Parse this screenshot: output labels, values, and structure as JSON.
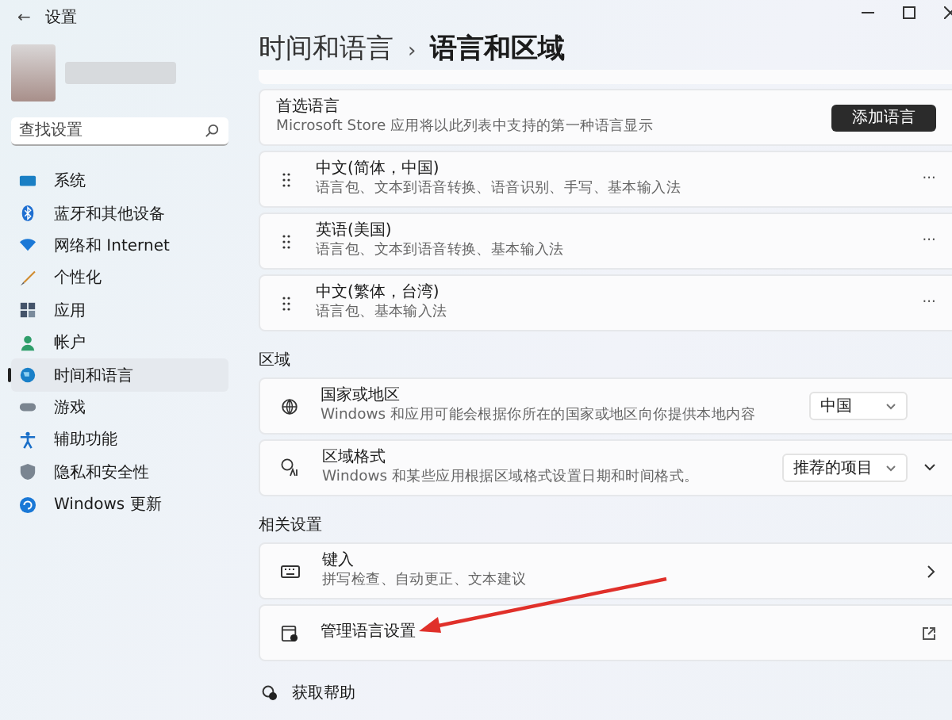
{
  "window": {
    "title": "设置",
    "back": "←"
  },
  "search": {
    "placeholder": "查找设置"
  },
  "sidebar": {
    "items": [
      {
        "label": "系统",
        "selected": false
      },
      {
        "label": "蓝牙和其他设备",
        "selected": false
      },
      {
        "label": "网络和 Internet",
        "selected": false
      },
      {
        "label": "个性化",
        "selected": false
      },
      {
        "label": "应用",
        "selected": false
      },
      {
        "label": "帐户",
        "selected": false
      },
      {
        "label": "时间和语言",
        "selected": true
      },
      {
        "label": "游戏",
        "selected": false
      },
      {
        "label": "辅助功能",
        "selected": false
      },
      {
        "label": "隐私和安全性",
        "selected": false
      },
      {
        "label": "Windows 更新",
        "selected": false
      }
    ]
  },
  "breadcrumb": {
    "parent": "时间和语言",
    "separator": "›",
    "current": "语言和区域"
  },
  "preferred_language": {
    "title": "首选语言",
    "subtitle": "Microsoft Store 应用将以此列表中支持的第一种语言显示",
    "button": "添加语言"
  },
  "languages": [
    {
      "name": "中文(简体，中国)",
      "features": "语言包、文本到语音转换、语音识别、手写、基本输入法",
      "menu": "···"
    },
    {
      "name": "英语(美国)",
      "features": "语言包、文本到语音转换、基本输入法",
      "menu": "···"
    },
    {
      "name": "中文(繁体，台湾)",
      "features": "语言包、基本输入法",
      "menu": "···"
    }
  ],
  "region": {
    "heading": "区域",
    "rows": [
      {
        "title": "国家或地区",
        "subtitle": "Windows 和应用可能会根据你所在的国家或地区向你提供本地内容",
        "value": "中国",
        "expandable": false
      },
      {
        "title": "区域格式",
        "subtitle": "Windows 和某些应用根据区域格式设置日期和时间格式。",
        "value": "推荐的项目",
        "expandable": true
      }
    ]
  },
  "related": {
    "heading": "相关设置",
    "rows": [
      {
        "title": "键入",
        "subtitle": "拼写检查、自动更正、文本建议",
        "kind": "chevron"
      },
      {
        "title": "管理语言设置",
        "kind": "external"
      }
    ]
  },
  "help": {
    "label": "获取帮助"
  }
}
